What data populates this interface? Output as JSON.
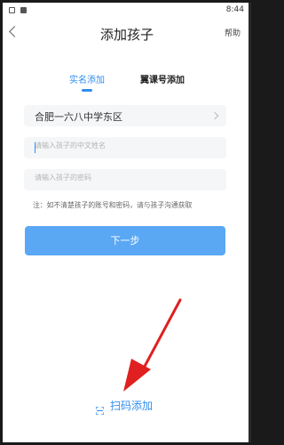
{
  "status_bar": {
    "time": "8:44"
  },
  "nav": {
    "title": "添加孩子",
    "help_label": "帮助"
  },
  "tabs": [
    {
      "label": "实名添加",
      "active": true
    },
    {
      "label": "翼课号添加",
      "active": false
    }
  ],
  "form": {
    "school": "合肥一六八中学东区",
    "name_placeholder": "请输入孩子的中文姓名",
    "password_placeholder": "请输入孩子的密码",
    "note": "注：如不清楚孩子的账号和密码，请与孩子沟通获取",
    "submit_label": "下一步"
  },
  "scan": {
    "label": "扫码添加"
  },
  "icons": {
    "back": "chevron-left-icon",
    "school_chevron": "chevron-right-icon",
    "scan": "scan-icon"
  },
  "colors": {
    "accent": "#2f8ef0",
    "button": "#5aa7f4",
    "field_bg": "#f4f6f8",
    "arrow": "#e02020"
  }
}
